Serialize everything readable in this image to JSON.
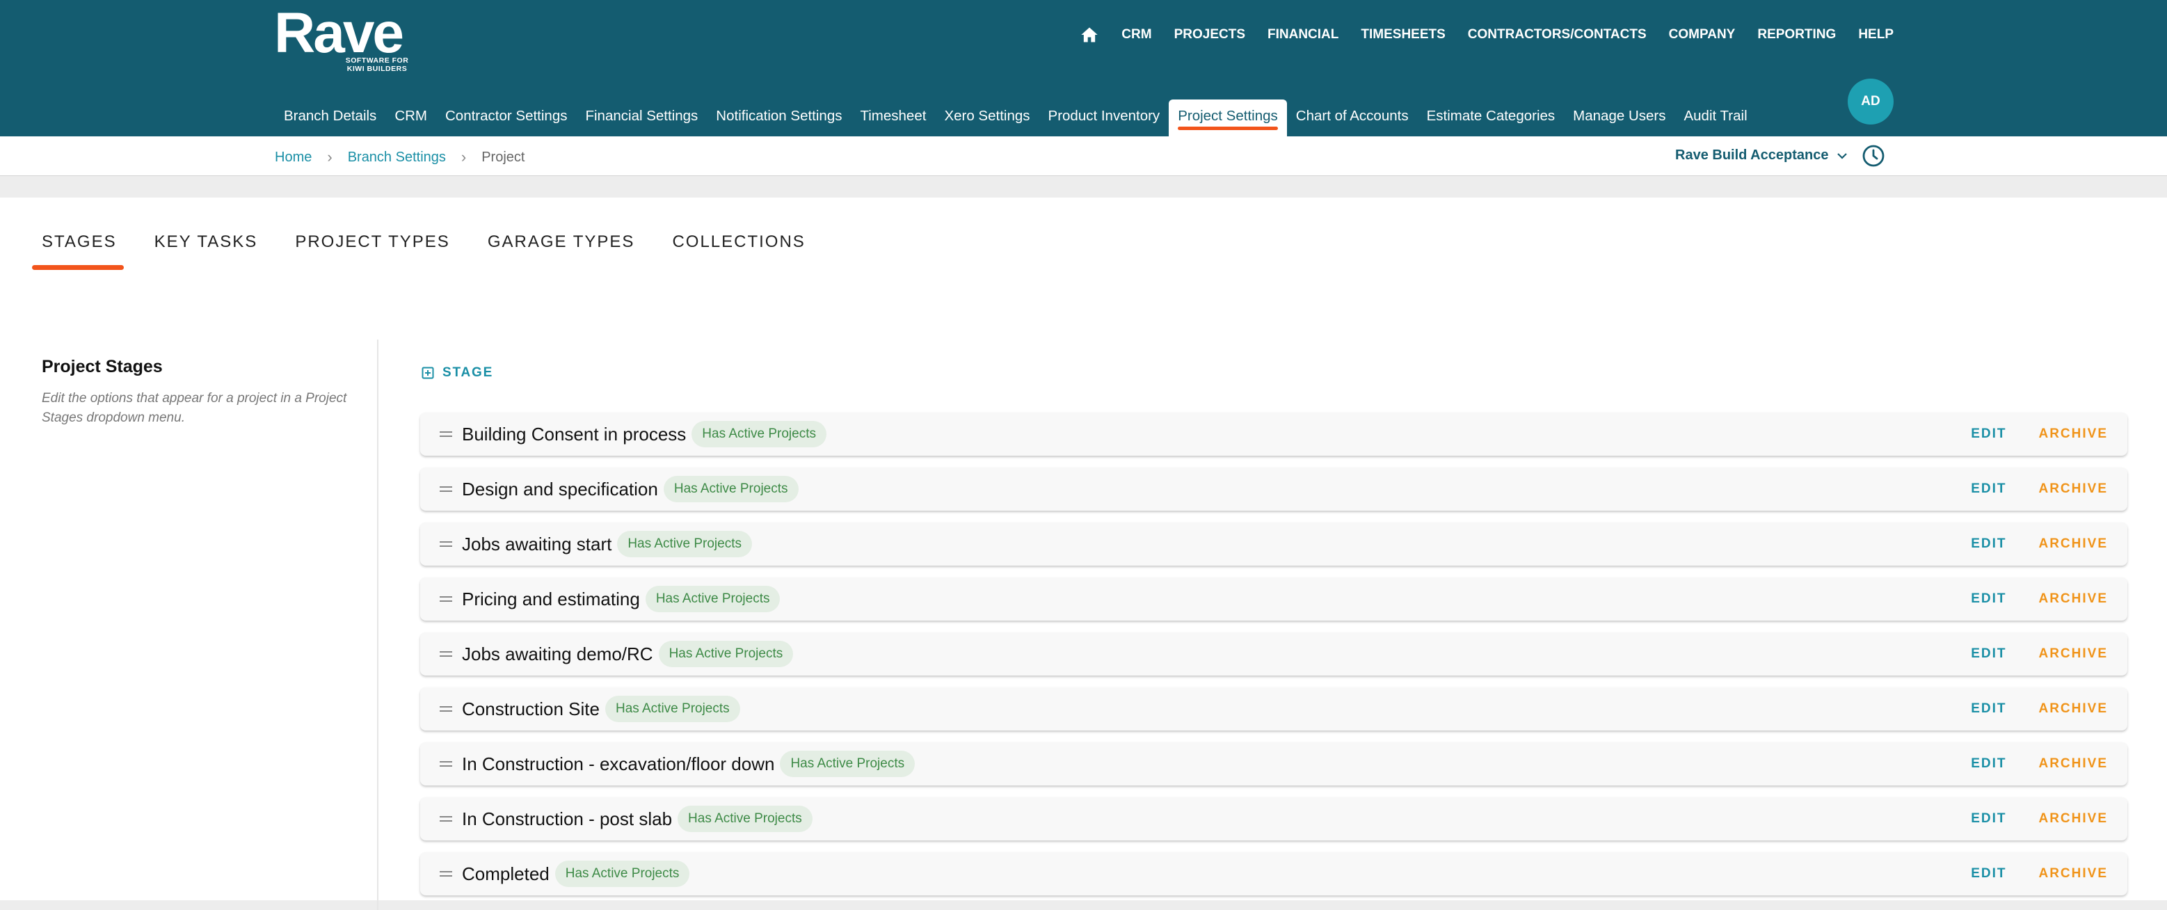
{
  "brand": {
    "logo_text": "Rave",
    "tagline": "SOFTWARE FOR KIWI BUILDERS"
  },
  "top_nav": {
    "home_icon": "home-icon",
    "items": [
      "CRM",
      "PROJECTS",
      "FINANCIAL",
      "TIMESHEETS",
      "CONTRACTORS/CONTACTS",
      "COMPANY",
      "REPORTING",
      "HELP"
    ]
  },
  "user": {
    "initials": "AD"
  },
  "sub_nav": {
    "items": [
      "Branch Details",
      "CRM",
      "Contractor Settings",
      "Financial Settings",
      "Notification Settings",
      "Timesheet",
      "Xero Settings",
      "Product Inventory",
      "Project Settings",
      "Chart of Accounts",
      "Estimate Categories",
      "Manage Users",
      "Audit Trail"
    ],
    "active": "Project Settings"
  },
  "breadcrumb": {
    "home": "Home",
    "branch_settings": "Branch Settings",
    "current": "Project"
  },
  "branch_select": {
    "value": "Rave Build Acceptance",
    "icon": "chevron-down-icon"
  },
  "history_icon": "clock-icon",
  "tabs": {
    "items": [
      "STAGES",
      "KEY TASKS",
      "PROJECT TYPES",
      "GARAGE TYPES",
      "COLLECTIONS"
    ],
    "active": "STAGES"
  },
  "section": {
    "title": "Project Stages",
    "description": "Edit the options that appear for a project in a Project Stages dropdown menu."
  },
  "add_stage_label": "STAGE",
  "stages": [
    {
      "name": "Building Consent in process",
      "badge": "Has Active Projects"
    },
    {
      "name": "Design and specification",
      "badge": "Has Active Projects"
    },
    {
      "name": "Jobs awaiting start",
      "badge": "Has Active Projects"
    },
    {
      "name": "Pricing and estimating",
      "badge": "Has Active Projects"
    },
    {
      "name": "Jobs awaiting demo/RC",
      "badge": "Has Active Projects"
    },
    {
      "name": "Construction Site",
      "badge": "Has Active Projects"
    },
    {
      "name": "In Construction - excavation/floor down",
      "badge": "Has Active Projects"
    },
    {
      "name": "In Construction - post slab",
      "badge": "Has Active Projects"
    },
    {
      "name": "Completed",
      "badge": "Has Active Projects"
    }
  ],
  "row_actions": {
    "edit": "EDIT",
    "archive": "ARCHIVE"
  },
  "colors": {
    "header": "#145c70",
    "accent": "#f2541b",
    "link": "#1a8fa6",
    "archive": "#f0941a",
    "badge_bg": "#e4eee4",
    "badge_text": "#3d8a46"
  }
}
